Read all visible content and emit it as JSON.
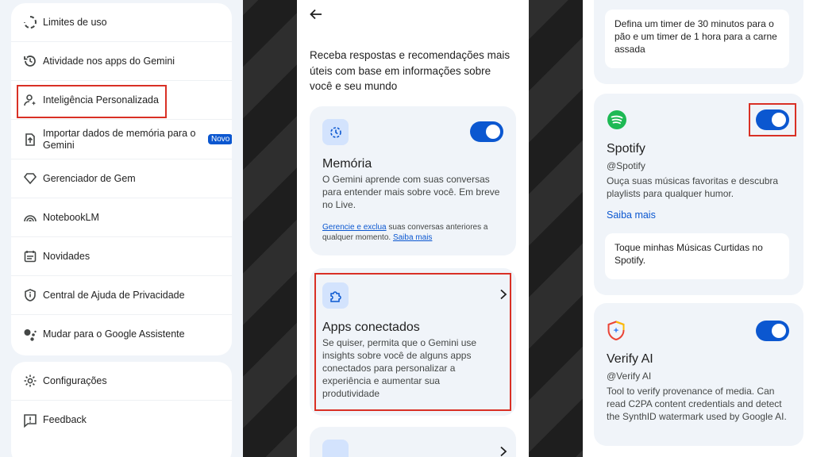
{
  "colors": {
    "accent": "#0b57d0",
    "highlight": "#d93025",
    "card_bg": "#f0f4f9"
  },
  "menu": {
    "group1": [
      {
        "icon": "usage-limits-icon",
        "label": "Limites de uso"
      },
      {
        "icon": "history-icon",
        "label": "Atividade nos apps do Gemini"
      },
      {
        "icon": "personalized-intelligence-icon",
        "label": "Inteligência Personalizada"
      },
      {
        "icon": "import-icon",
        "label": "Importar dados de memória para o Gemini",
        "badge": "Novo"
      },
      {
        "icon": "gem-icon",
        "label": "Gerenciador de Gem"
      },
      {
        "icon": "notebooklm-icon",
        "label": "NotebookLM"
      },
      {
        "icon": "news-icon",
        "label": "Novidades"
      },
      {
        "icon": "privacy-shield-icon",
        "label": "Central de Ajuda de Privacidade"
      },
      {
        "icon": "assistant-icon",
        "label": "Mudar para o Google Assistente"
      }
    ],
    "group2": [
      {
        "icon": "gear-icon",
        "label": "Configurações"
      },
      {
        "icon": "feedback-icon",
        "label": "Feedback"
      }
    ]
  },
  "personalization": {
    "intro": "Receba respostas e recomendações mais úteis com base em informações sobre você e seu mundo",
    "memory": {
      "title": "Memória",
      "body": "O Gemini aprende com suas conversas para entender mais sobre você. Em breve no Live.",
      "link1": "Gerencie e exclua",
      "note": " suas conversas anteriores a qualquer momento. ",
      "link2": "Saiba mais",
      "toggle_on": true
    },
    "connected_apps": {
      "title": "Apps conectados",
      "body": "Se quiser, permita que o Gemini use insights sobre você de alguns apps conectados para personalizar a experiência e aumentar sua produtividade"
    }
  },
  "apps": {
    "prompt_example_1": "Defina um timer de 30 minutos para o pão e um timer de 1 hora para a carne assada",
    "spotify": {
      "name": "Spotify",
      "handle": "@Spotify",
      "description": "Ouça suas músicas favoritas e descubra playlists para qualquer humor.",
      "learn_more": "Saiba mais",
      "example": "Toque minhas Músicas Curtidas no Spotify.",
      "toggle_on": true
    },
    "verify_ai": {
      "name": "Verify AI",
      "handle": "@Verify AI",
      "description": "Tool to verify provenance of media. Can read C2PA content credentials and detect the SynthID watermark used by Google AI.",
      "toggle_on": true
    }
  }
}
